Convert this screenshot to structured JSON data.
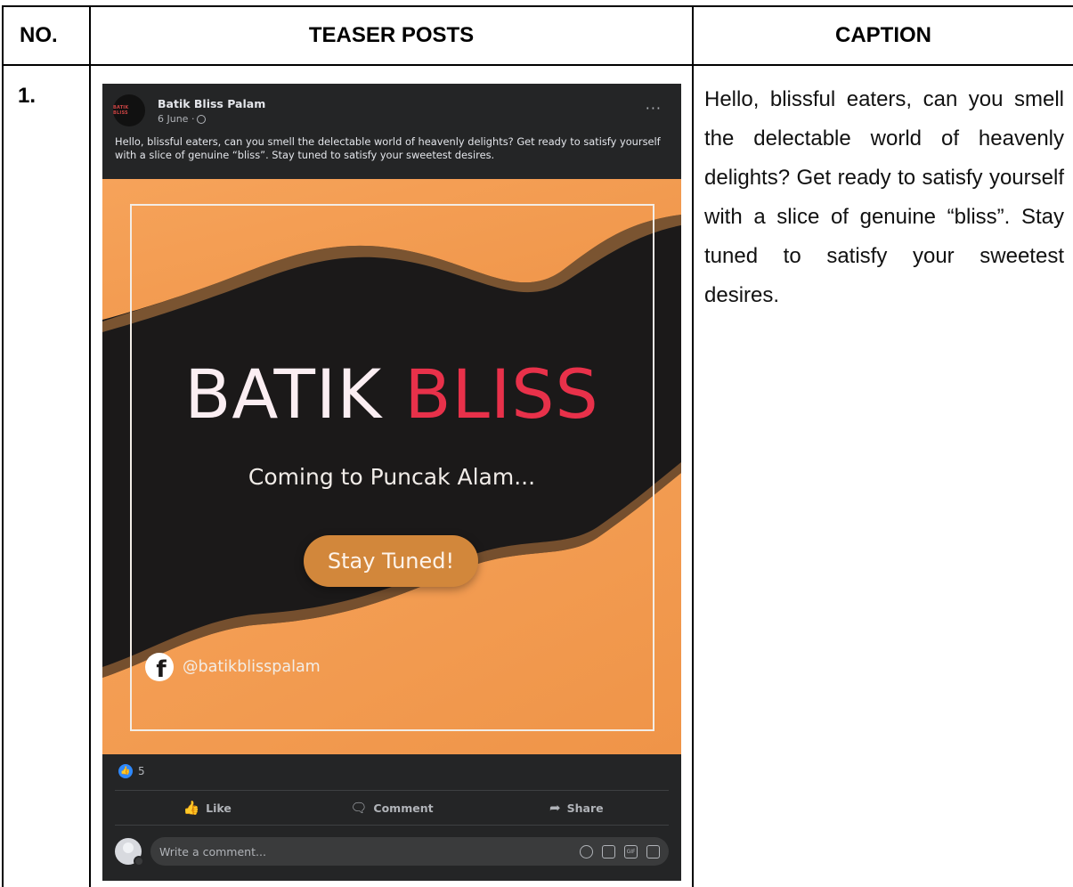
{
  "table": {
    "headers": {
      "no": "NO.",
      "posts": "TEASER POSTS",
      "caption": "CAPTION"
    },
    "rows": [
      {
        "no": "1.",
        "caption": "Hello, blissful eaters, can you smell the delectable world of heavenly delights? Get ready to satisfy yourself with a slice of genuine “bliss”. Stay tuned to satisfy your sweetest desires."
      }
    ]
  },
  "post": {
    "avatar_text": "BATIK BLISS",
    "page_name": "Batik Bliss Palam",
    "date": "6 June ·",
    "more": "···",
    "text": "Hello, blissful eaters, can you smell the delectable world of heavenly delights? Get ready to satisfy yourself with a slice of genuine “bliss”. Stay tuned to satisfy your sweetest desires.",
    "image": {
      "title_word1": "BATIK",
      "title_word2": "BLISS",
      "subtitle": "Coming to Puncak Alam...",
      "cta": "Stay Tuned!",
      "fb_glyph": "f",
      "handle": "@batikblisspalam"
    },
    "reaction_count": "5",
    "actions": {
      "like": "Like",
      "comment": "Comment",
      "share": "Share"
    },
    "comment_placeholder": "Write a comment...",
    "comment_tools": [
      "emoji-icon",
      "camera-icon",
      "gif-icon",
      "sticker-icon"
    ],
    "gif_label": "GIF"
  },
  "colors": {
    "post_bg": "#242526",
    "image_dark": "#1b1919",
    "image_orange": "#f39a4c",
    "brand_red": "#e8314a",
    "cta_orange": "#d2873b",
    "like_blue": "#2e89ff"
  }
}
